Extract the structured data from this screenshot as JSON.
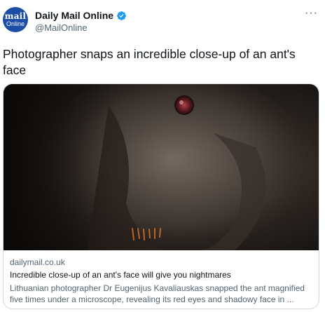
{
  "author": {
    "avatar_line1": "mail",
    "avatar_line2": "Online",
    "display_name": "Daily Mail Online",
    "handle": "@MailOnline",
    "verified": true
  },
  "more_label": "···",
  "tweet": {
    "text": "Photographer snaps an incredible close-up of an ant's face"
  },
  "card": {
    "domain": "dailymail.co.uk",
    "title": "Incredible close-up of an ant's face will give you nightmares",
    "description": "Lithuanian photographer Dr Eugenijus Kavaliauskas snapped the ant magnified five times under a microscope, revealing its red eyes and shadowy face in ..."
  },
  "colors": {
    "avatar_bg": "#1d4ea6",
    "verified": "#1d9bf0",
    "secondary_text": "#536471",
    "border": "#cfd9de"
  }
}
